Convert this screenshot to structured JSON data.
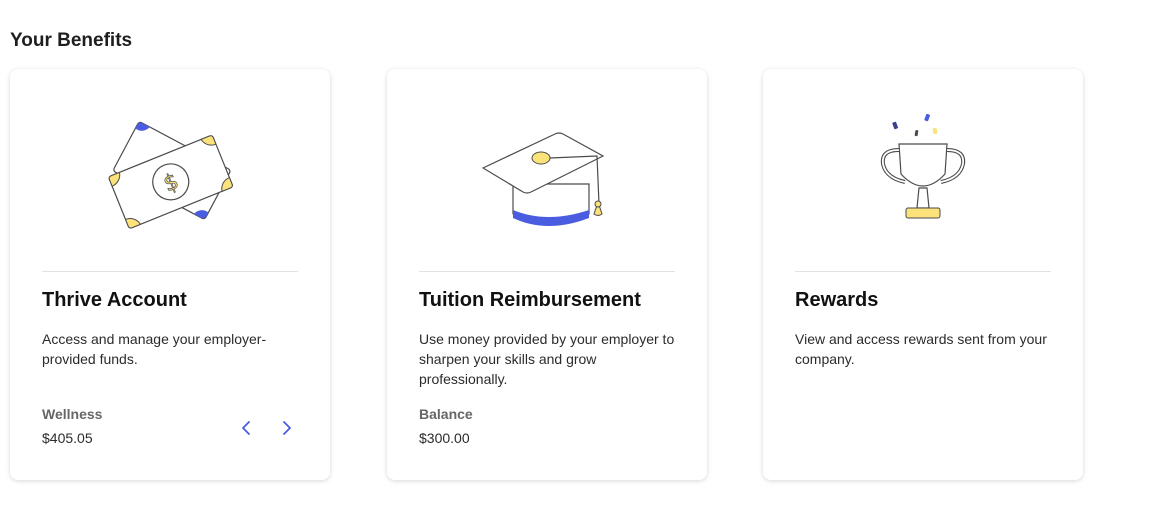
{
  "page": {
    "title": "Your Benefits"
  },
  "colors": {
    "accent_blue": "#4a5ce0",
    "accent_yellow": "#fbe27a",
    "outline": "#4b4b4b"
  },
  "cards": [
    {
      "title": "Thrive Account",
      "description": "Access and manage your employer-provided funds.",
      "balance_label": "Wellness",
      "balance_value": "$405.05",
      "icon": "money-bills-icon",
      "nav": {
        "prev_icon": "chevron-left-icon",
        "next_icon": "chevron-right-icon"
      }
    },
    {
      "title": "Tuition Reimbursement",
      "description": "Use money provided by your employer to sharpen your skills and grow professionally.",
      "balance_label": "Balance",
      "balance_value": "$300.00",
      "icon": "graduation-cap-icon"
    },
    {
      "title": "Rewards",
      "description": "View and access rewards sent from your company.",
      "icon": "trophy-icon"
    }
  ]
}
